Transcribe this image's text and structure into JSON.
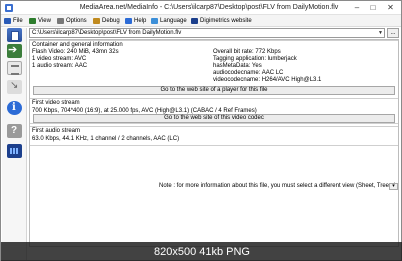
{
  "window": {
    "title": "MediaArea.net/MediaInfo - C:\\Users\\ilcarp87\\Desktop\\post\\FLV from DailyMotion.flv",
    "minimize_glyph": "–",
    "maximize_glyph": "□",
    "close_glyph": "✕"
  },
  "menu": {
    "items": [
      {
        "label": "File",
        "icon": "file-icon",
        "color": "#2a5bb8"
      },
      {
        "label": "View",
        "icon": "view-icon",
        "color": "#2d7d2d"
      },
      {
        "label": "Options",
        "icon": "options-icon",
        "color": "#777777"
      },
      {
        "label": "Debug",
        "icon": "debug-icon",
        "color": "#c08a1e"
      },
      {
        "label": "Help",
        "icon": "help-icon",
        "color": "#2c6bd6"
      },
      {
        "label": "Language",
        "icon": "language-icon",
        "color": "#3c8fd8"
      },
      {
        "label": "Digimetrics website",
        "icon": "digimetrics-icon",
        "color": "#1c3f8c"
      }
    ]
  },
  "toolbar_icons": [
    "open-file-icon",
    "export-icon",
    "sheet-view-icon",
    "tree-view-icon",
    "info-icon",
    "help-icon",
    "spectrum-icon"
  ],
  "file_combo": {
    "value": "C:\\Users\\ilcarp87\\Desktop\\post\\FLV from DailyMotion.flv",
    "side_button": "..."
  },
  "general": {
    "header": "Container and general information",
    "left": [
      "Flash Video: 240 MiB, 43mn 32s",
      "1 video stream: AVC",
      "1 audio stream: AAC"
    ],
    "right": [
      "Overall bit rate: 772 Kbps",
      "Tagging application: lumberjack",
      "hasMetaData: Yes",
      "audiocodecname: AAC LC",
      "videocodecname: H264/AVC High@L3.1"
    ],
    "button": "Go to the web site of a player for this file"
  },
  "video": {
    "header": "First video stream",
    "line": "700 Kbps, 704*400 (16:9), at 25.000 fps, AVC (High@L3.1) (CABAC / 4 Ref Frames)",
    "button": "Go to the web site of this video codec"
  },
  "audio": {
    "header": "First audio stream",
    "line": "63.0 Kbps, 44.1 KHz, 1 channel / 2 channels, AAC (LC)"
  },
  "note": "Note : for more information about this file, you must select a different view (Sheet, Tree...)",
  "footer": "820x500  41kb  PNG"
}
